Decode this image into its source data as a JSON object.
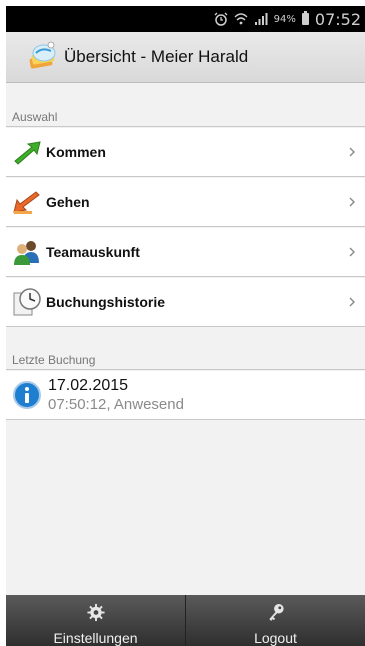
{
  "status_bar": {
    "battery_percent": "94%",
    "time": "07:52",
    "icons": [
      "alarm-icon",
      "wifi-icon",
      "signal-icon",
      "battery-icon"
    ]
  },
  "action_bar": {
    "title": "Übersicht - Meier Harald",
    "icon": "app-logo-icon"
  },
  "sections": {
    "auswahl": "Auswahl",
    "letzte_buchung": "Letzte Buchung"
  },
  "menu": [
    {
      "label": "Kommen",
      "icon": "arrow-up-right-green-icon"
    },
    {
      "label": "Gehen",
      "icon": "arrow-down-left-orange-icon"
    },
    {
      "label": "Teamauskunft",
      "icon": "team-icon"
    },
    {
      "label": "Buchungshistorie",
      "icon": "clock-history-icon"
    }
  ],
  "last_booking": {
    "date": "17.02.2015",
    "detail": "07:50:12, Anwesend",
    "icon": "info-icon"
  },
  "bottom_tabs": [
    {
      "label": "Einstellungen",
      "icon": "gear-icon"
    },
    {
      "label": "Logout",
      "icon": "key-icon"
    }
  ],
  "colors": {
    "info_blue": "#1e7fd0",
    "kommen_green": "#3fae2a",
    "gehen_orange": "#e8692a"
  }
}
